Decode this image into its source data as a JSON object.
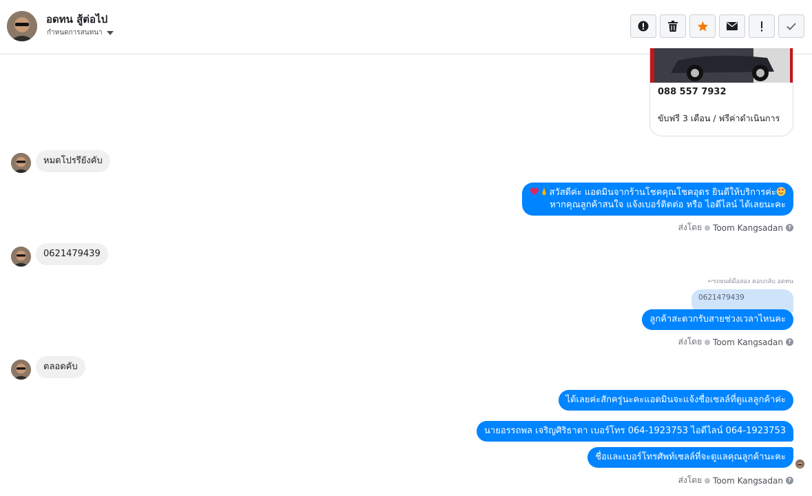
{
  "header": {
    "contact_name": "อดทน สู้ต่อไป",
    "subtitle": "กำหนดการสนทนา"
  },
  "toolbar": {
    "buttons": [
      {
        "name": "report-icon"
      },
      {
        "name": "trash-icon"
      },
      {
        "name": "star-icon",
        "color": "#f57c00"
      },
      {
        "name": "mail-icon"
      },
      {
        "name": "important-icon"
      },
      {
        "name": "check-icon"
      }
    ]
  },
  "card": {
    "phone": "088 557 7932",
    "description": "ขับฟรี 3 เดือน / ฟรีค่าดำเนินการ"
  },
  "messages": {
    "in1": "หมดโปรรึยังคับ",
    "out1_line1": "สวัสดีค่ะ แอดมินจากร้านโชคคุณโชคอุดร ยินดีให้บริการค่ะ",
    "out1_line2": "หากคุณลูกค้าสนใจ แจ้งเบอร์ติดต่อ หรือ ไอดีไลน์ ได้เลยนะคะ",
    "in2": "0621479439",
    "reply_note": "รถยนต์มือสอง ตอบกลับ อดทน",
    "quoted": "0621479439",
    "out2": "ลูกค้าสะดวกรับสายช่วงเวลาไหนคะ",
    "in3": "ตลอดคับ",
    "out3": "ได้เลยค่ะสักครู่นะคะแอดมินจะแจ้งชื่อเซลล์ที่ดูแลลูกค้าค่ะ",
    "out4": "นายอรรถพล เจริญศิริธาดา     เบอร์โทร 064-1923753 ไอดีไลน์ 064-1923753",
    "out5": "ชื่อและเบอร์โทรศัพท์เซลล์ที่จะดูแลคุณลูกค้านะคะ"
  },
  "sent_by": {
    "label": "ส่งโดย",
    "agent": "Toom Kangsadan"
  },
  "colors": {
    "accent": "#0084ff",
    "incoming_bubble": "#f0f0f0"
  }
}
